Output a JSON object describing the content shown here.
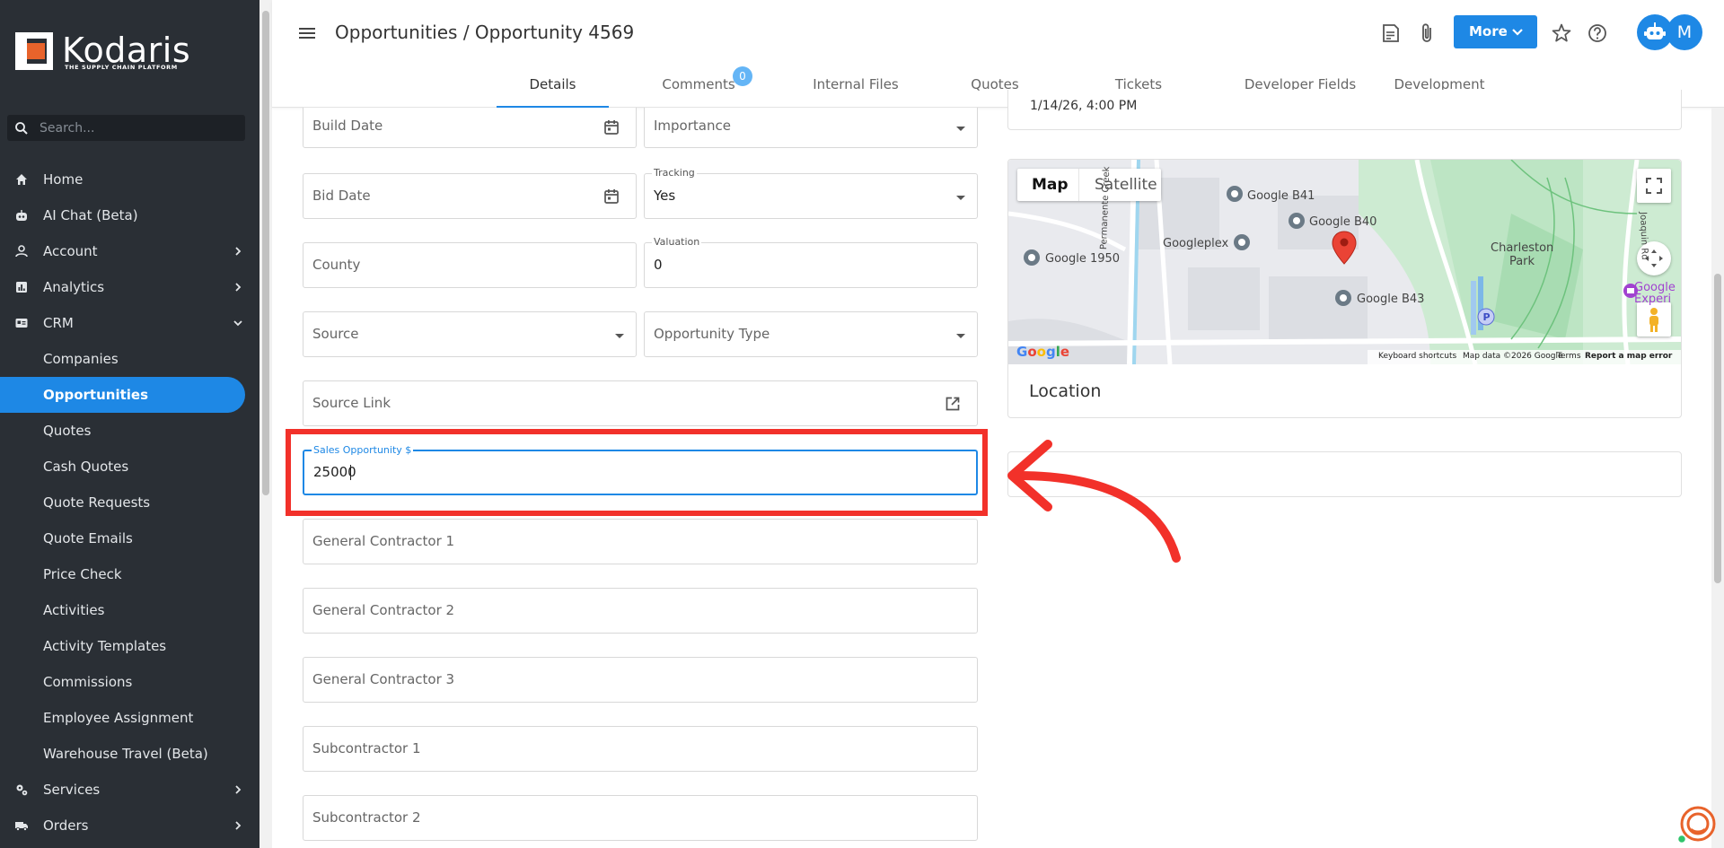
{
  "app": {
    "logo_text": "Kodaris",
    "logo_tagline": "THE SUPPLY CHAIN PLATFORM"
  },
  "sidebar": {
    "search_placeholder": "Search...",
    "items": [
      {
        "label": "Home",
        "icon": "home-icon"
      },
      {
        "label": "AI Chat (Beta)",
        "icon": "robot-icon"
      },
      {
        "label": "Account",
        "icon": "person-icon"
      },
      {
        "label": "Analytics",
        "icon": "chart-icon"
      },
      {
        "label": "CRM",
        "icon": "crm-icon"
      }
    ],
    "crm_subitems": [
      "Companies",
      "Opportunities",
      "Quotes",
      "Cash Quotes",
      "Quote Requests",
      "Quote Emails",
      "Price Check",
      "Activities",
      "Activity Templates",
      "Commissions",
      "Employee Assignment",
      "Warehouse Travel (Beta)"
    ],
    "bottom_items": [
      {
        "label": "Services",
        "icon": "services-icon"
      },
      {
        "label": "Orders",
        "icon": "truck-icon"
      }
    ],
    "active_item": "Opportunities"
  },
  "header": {
    "title": "Opportunities / Opportunity 4569",
    "more_label": "More",
    "avatar_initial": "M"
  },
  "tabs": [
    {
      "label": "Details",
      "active": true
    },
    {
      "label": "Comments",
      "badge": "0"
    },
    {
      "label": "Internal Files"
    },
    {
      "label": "Quotes"
    },
    {
      "label": "Tickets"
    },
    {
      "label": "Developer Fields"
    },
    {
      "label": "Development"
    }
  ],
  "form": {
    "build_date": {
      "placeholder": "Build Date"
    },
    "importance": {
      "placeholder": "Importance"
    },
    "bid_date": {
      "placeholder": "Bid Date"
    },
    "tracking": {
      "label": "Tracking",
      "value": "Yes"
    },
    "county": {
      "placeholder": "County"
    },
    "valuation": {
      "label": "Valuation",
      "value": "0"
    },
    "source": {
      "placeholder": "Source"
    },
    "opportunity_type": {
      "placeholder": "Opportunity Type"
    },
    "source_link": {
      "placeholder": "Source Link"
    },
    "sales_opportunity": {
      "label": "Sales Opportunity $",
      "value": "25000"
    },
    "general_contractor_1": {
      "placeholder": "General Contractor 1"
    },
    "general_contractor_2": {
      "placeholder": "General Contractor 2"
    },
    "general_contractor_3": {
      "placeholder": "General Contractor 3"
    },
    "subcontractor_1": {
      "placeholder": "Subcontractor 1"
    },
    "subcontractor_2": {
      "placeholder": "Subcontractor 2"
    }
  },
  "right": {
    "top_partial_value": "1/14/26, 4:00 PM",
    "map": {
      "toggle_map": "Map",
      "toggle_satellite": "Satellite",
      "labels": [
        "Google B41",
        "Google B40",
        "Googleplex",
        "Google 1950",
        "Google B43",
        "Charleston Park",
        "Permanente Creek",
        "Joaquin Rd",
        "Google Experi"
      ],
      "footer": [
        "Keyboard shortcuts",
        "Map data ©2026 Google",
        "Terms",
        "Report a map error"
      ]
    },
    "location_label": "Location"
  },
  "colors": {
    "accent": "#1e88e5",
    "sidebar_bg": "#2a2f35",
    "highlight_red": "#f2312a"
  }
}
